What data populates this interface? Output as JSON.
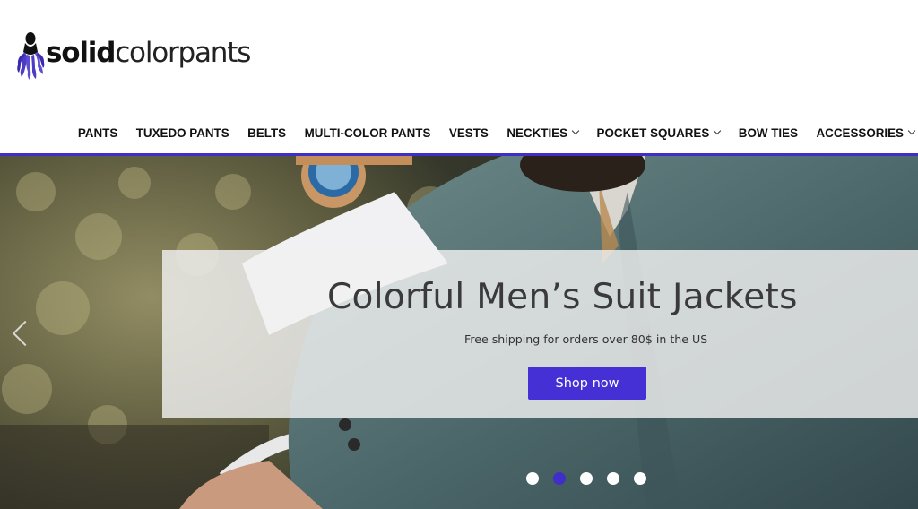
{
  "brand": {
    "name_bold": "solid",
    "name_light": "colorpants",
    "accent_color": "#4530d6"
  },
  "nav": {
    "items": [
      {
        "label": "PANTS",
        "dropdown": false
      },
      {
        "label": "TUXEDO PANTS",
        "dropdown": false
      },
      {
        "label": "BELTS",
        "dropdown": false
      },
      {
        "label": "MULTI-COLOR PANTS",
        "dropdown": false
      },
      {
        "label": "VESTS",
        "dropdown": false
      },
      {
        "label": "NECKTIES",
        "dropdown": true
      },
      {
        "label": "POCKET SQUARES",
        "dropdown": true
      },
      {
        "label": "BOW TIES",
        "dropdown": false
      },
      {
        "label": "ACCESSORIES",
        "dropdown": true
      }
    ]
  },
  "hero": {
    "title": "Colorful Men’s Suit Jackets",
    "subtitle": "Free shipping for orders over 80$ in the US",
    "cta_label": "Shop now",
    "slides_total": 5,
    "active_slide": 2,
    "prev_icon": "chevron-left-icon"
  }
}
